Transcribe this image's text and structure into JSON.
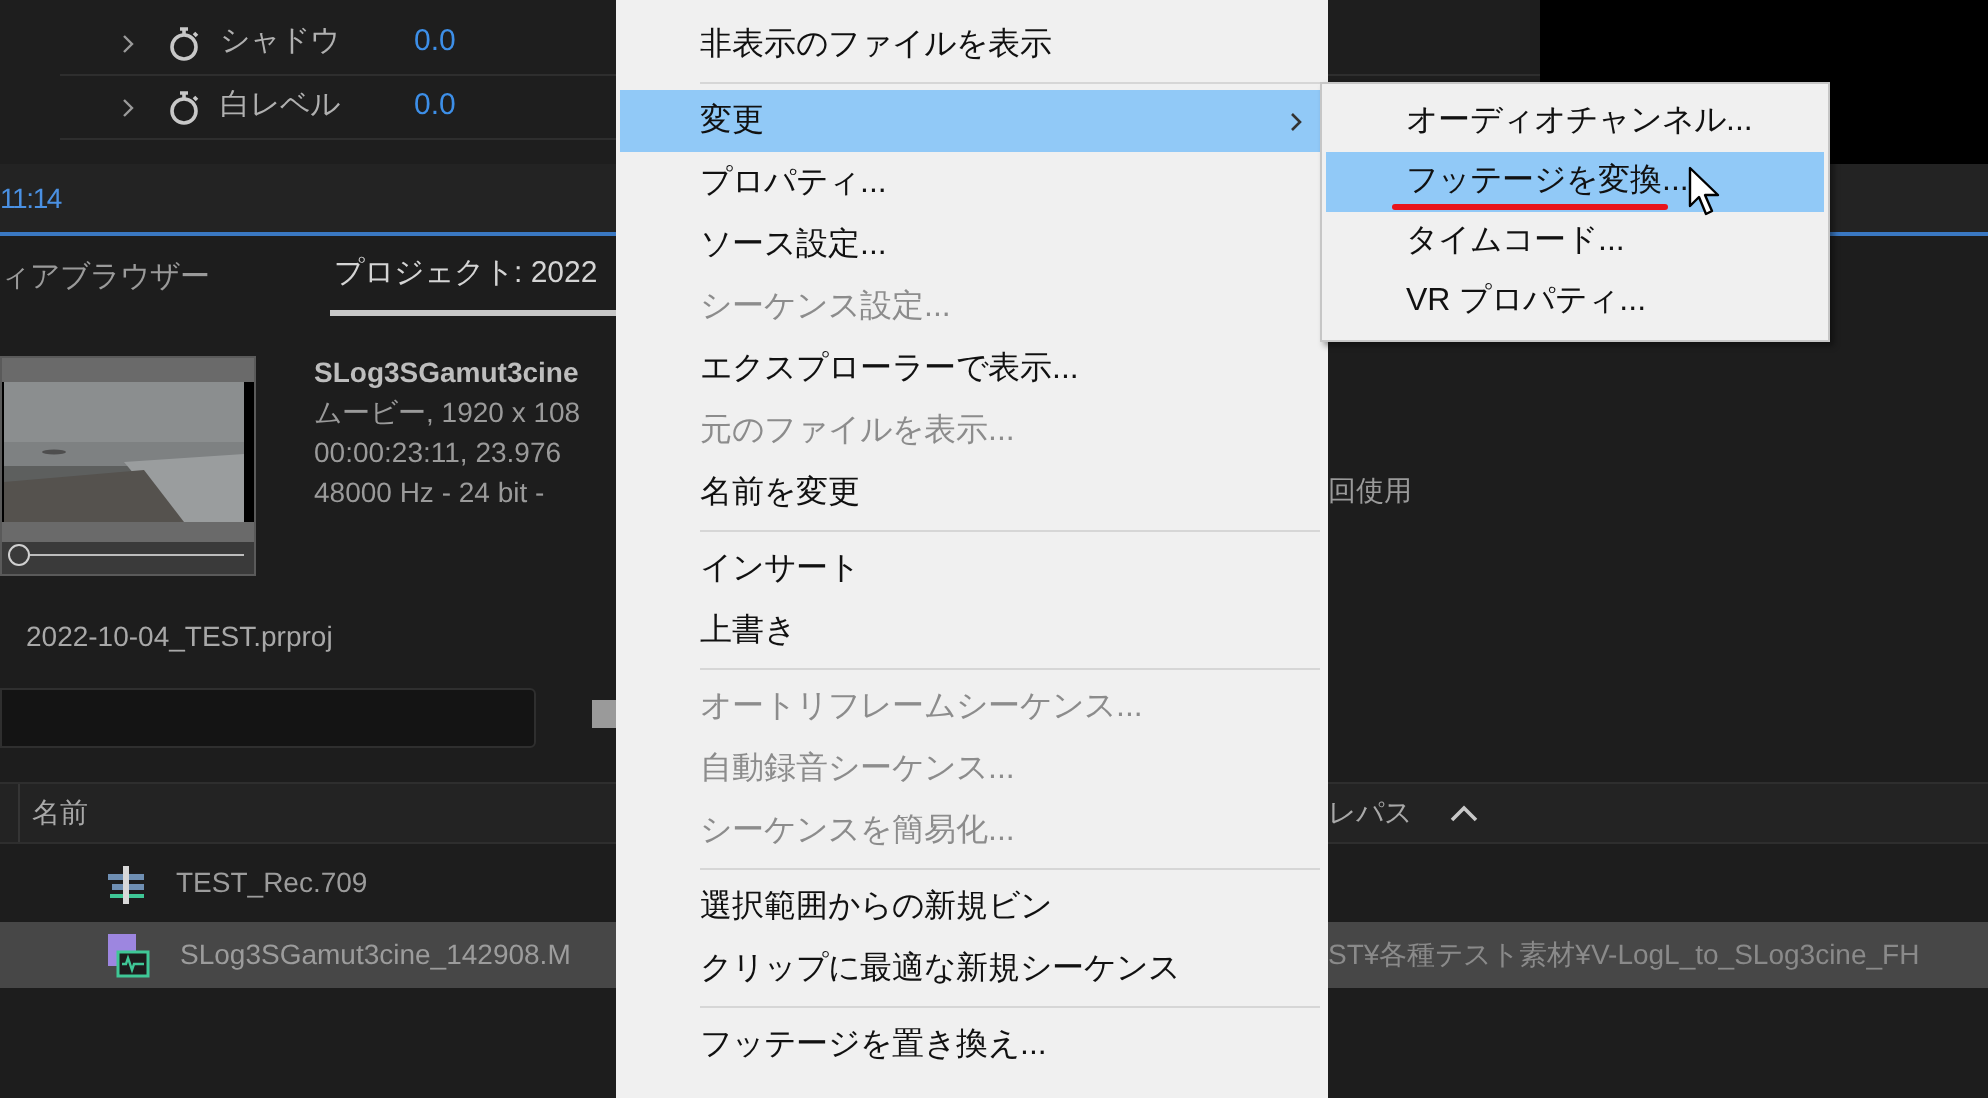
{
  "effects": [
    {
      "label": "シャドウ",
      "value": "0.0"
    },
    {
      "label": "白レベル",
      "value": "0.0"
    }
  ],
  "timecode": "11:14",
  "tabs": [
    {
      "label": "ィアブラウザー",
      "selected": false
    },
    {
      "label": "プロジェクト: 2022",
      "selected": true
    }
  ],
  "clip_info": {
    "name": "SLog3SGamut3cine",
    "lines": [
      "ムービー, 1920 x 108",
      "00:00:23:11, 23.976",
      "48000 Hz - 24 bit -"
    ],
    "usage": "回使用",
    "scrubber": {
      "level": 0
    }
  },
  "project_file": "2022-10-04_TEST.prproj",
  "columns": [
    "名前",
    "レパス"
  ],
  "rows": [
    {
      "kind": "sequence",
      "name": "TEST_Rec.709",
      "selected": false
    },
    {
      "kind": "clip",
      "name": "SLog3SGamut3cine_142908.M",
      "path": "ST¥各種テスト素材¥V-LogL_to_SLog3cine_FH",
      "selected": true
    }
  ],
  "context_menu": {
    "items": [
      {
        "kind": "item",
        "label": "非表示のファイルを表示",
        "selected": false,
        "disabled": false,
        "submenu": false
      },
      {
        "kind": "separator"
      },
      {
        "kind": "item",
        "label": "変更",
        "selected": true,
        "disabled": false,
        "submenu": true
      },
      {
        "kind": "item",
        "label": "プロパティ...",
        "selected": false,
        "disabled": false,
        "submenu": false
      },
      {
        "kind": "item",
        "label": "ソース設定...",
        "selected": false,
        "disabled": false,
        "submenu": false
      },
      {
        "kind": "item",
        "label": "シーケンス設定...",
        "selected": false,
        "disabled": true,
        "submenu": false
      },
      {
        "kind": "item",
        "label": "エクスプローラーで表示...",
        "selected": false,
        "disabled": false,
        "submenu": false
      },
      {
        "kind": "item",
        "label": "元のファイルを表示...",
        "selected": false,
        "disabled": true,
        "submenu": false
      },
      {
        "kind": "item",
        "label": "名前を変更",
        "selected": false,
        "disabled": false,
        "submenu": false
      },
      {
        "kind": "separator"
      },
      {
        "kind": "item",
        "label": "インサート",
        "selected": false,
        "disabled": false,
        "submenu": false
      },
      {
        "kind": "item",
        "label": "上書き",
        "selected": false,
        "disabled": false,
        "submenu": false
      },
      {
        "kind": "separator"
      },
      {
        "kind": "item",
        "label": "オートリフレームシーケンス...",
        "selected": false,
        "disabled": true,
        "submenu": false
      },
      {
        "kind": "item",
        "label": "自動録音シーケンス...",
        "selected": false,
        "disabled": true,
        "submenu": false
      },
      {
        "kind": "item",
        "label": "シーケンスを簡易化...",
        "selected": false,
        "disabled": true,
        "submenu": false
      },
      {
        "kind": "separator"
      },
      {
        "kind": "item",
        "label": "選択範囲からの新規ビン",
        "selected": false,
        "disabled": false,
        "submenu": false
      },
      {
        "kind": "item",
        "label": "クリップに最適な新規シーケンス",
        "selected": false,
        "disabled": false,
        "submenu": false
      },
      {
        "kind": "separator"
      },
      {
        "kind": "item",
        "label": "フッテージを置き換え...",
        "selected": false,
        "disabled": false,
        "submenu": false
      }
    ]
  },
  "submenu": {
    "items": [
      {
        "label": "オーディオチャンネル...",
        "selected": false,
        "underlined": false
      },
      {
        "label": "フッテージを変換...",
        "selected": true,
        "underlined": true
      },
      {
        "label": "タイムコード...",
        "selected": false,
        "underlined": false
      },
      {
        "label": "VR プロパティ...",
        "selected": false,
        "underlined": false
      }
    ]
  }
}
